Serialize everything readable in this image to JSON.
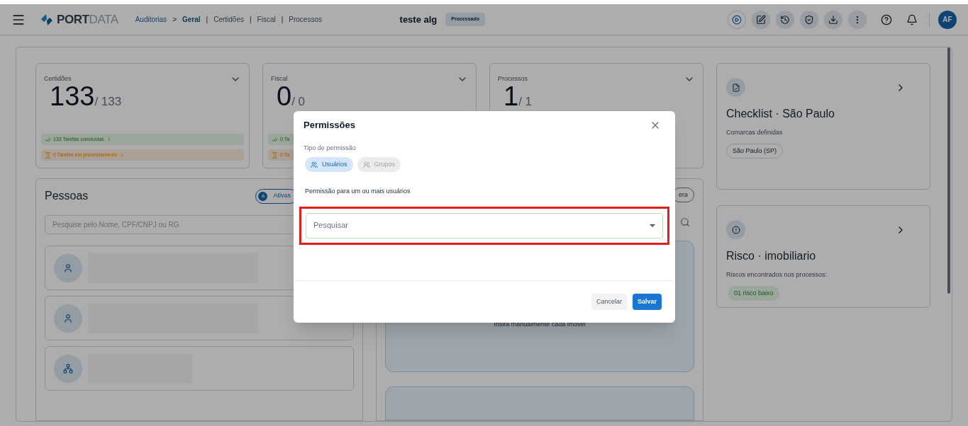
{
  "header": {
    "brand": {
      "bold": "PORT",
      "light": "DATA"
    },
    "breadcrumbs": [
      {
        "label": "Auditorias",
        "kind": "link",
        "selected": false
      },
      {
        "label": ">",
        "kind": "sep"
      },
      {
        "label": "Geral",
        "kind": "link",
        "selected": true
      },
      {
        "label": "|",
        "kind": "sep"
      },
      {
        "label": "Certidões",
        "kind": "link",
        "selected": false
      },
      {
        "label": "|",
        "kind": "sep"
      },
      {
        "label": "Fiscal",
        "kind": "link",
        "selected": false
      },
      {
        "label": "|",
        "kind": "sep"
      },
      {
        "label": "Processos",
        "kind": "link",
        "selected": false
      }
    ],
    "title": "teste alg",
    "status": "Processado",
    "actions": [
      {
        "kind": "play"
      },
      {
        "kind": "edit"
      },
      {
        "kind": "history"
      },
      {
        "kind": "shield"
      },
      {
        "kind": "download"
      },
      {
        "kind": "more"
      }
    ],
    "avatar": "AF"
  },
  "summary_cards": [
    {
      "title": "Certidões",
      "value": "133",
      "total": "/ 133",
      "done": "133 Tarefas concluídas",
      "pending": "0 Tarefas em processamento"
    },
    {
      "title": "Fiscal",
      "value": "0",
      "total": "/ 0",
      "done": "0 Ta",
      "pending": "0 Ta"
    },
    {
      "title": "Processos",
      "value": "1",
      "total": "/ 1"
    }
  ],
  "people": {
    "title": "Pessoas",
    "chip": {
      "count": "a",
      "label": "Ativas"
    },
    "search": {
      "placeholder": "Pesquise pelo Nome, CPF/CNPJ ou RG"
    },
    "rows": [
      {
        "kind": "person"
      },
      {
        "kind": "person"
      },
      {
        "kind": "company"
      }
    ]
  },
  "properties": {
    "chip": "era",
    "add_card": {
      "subtitle": "Insira manualmente cada imóvel"
    }
  },
  "checklist": {
    "title": "Checklist · São Paulo",
    "subtitle": "Comarcas definidas",
    "tag": "São Paulo (SP)"
  },
  "risk": {
    "title": "Risco · imobiliario",
    "subtitle": "Riscos encontrados nos processos:",
    "tag": "01 risco baixo"
  },
  "dialog": {
    "title": "Permissões",
    "type_label": "Tipo de permissão",
    "types": [
      {
        "label": "Usuários",
        "kind": "users",
        "selected": true
      },
      {
        "label": "Grupos",
        "kind": "groups",
        "selected": false
      }
    ],
    "hint": "Permissão para um ou mais usuários",
    "select": {
      "placeholder": "Pesquisar"
    },
    "highlighted": true,
    "buttons": [
      {
        "label": "Cancelar",
        "kind": "secondary"
      },
      {
        "label": "Salvar",
        "kind": "primary"
      }
    ]
  }
}
